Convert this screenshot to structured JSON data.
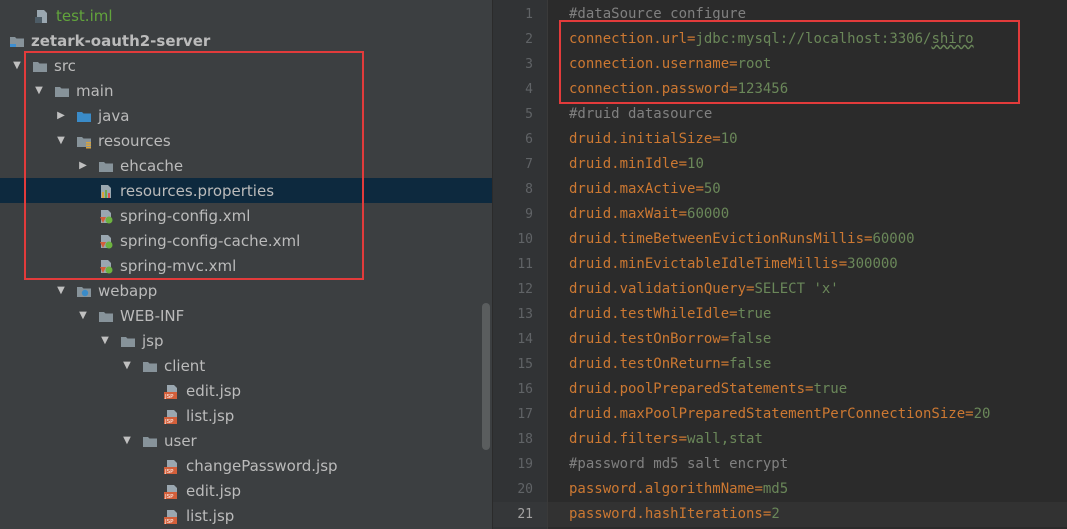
{
  "tree": {
    "items": [
      {
        "label": "test.iml",
        "icon": "iml-file-icon",
        "arrow": "none",
        "indent": 0,
        "green": true
      },
      {
        "label": "zetark-oauth2-server",
        "icon": "module-folder-icon",
        "arrow": "none",
        "indent": 0,
        "bold": true
      },
      {
        "label": "src",
        "icon": "folder-icon",
        "arrow": "expanded",
        "indent": 0
      },
      {
        "label": "main",
        "icon": "folder-icon",
        "arrow": "expanded",
        "indent": 1
      },
      {
        "label": "java",
        "icon": "source-folder-icon",
        "arrow": "collapsed",
        "indent": 2
      },
      {
        "label": "resources",
        "icon": "resources-folder-icon",
        "arrow": "expanded",
        "indent": 2
      },
      {
        "label": "ehcache",
        "icon": "folder-icon",
        "arrow": "collapsed",
        "indent": 3
      },
      {
        "label": "resources.properties",
        "icon": "properties-file-icon",
        "arrow": "none",
        "indent": 3,
        "selected": true
      },
      {
        "label": "spring-config.xml",
        "icon": "spring-xml-icon",
        "arrow": "none",
        "indent": 3
      },
      {
        "label": "spring-config-cache.xml",
        "icon": "spring-xml-icon",
        "arrow": "none",
        "indent": 3
      },
      {
        "label": "spring-mvc.xml",
        "icon": "spring-xml-icon",
        "arrow": "none",
        "indent": 3
      },
      {
        "label": "webapp",
        "icon": "web-folder-icon",
        "arrow": "expanded",
        "indent": 2
      },
      {
        "label": "WEB-INF",
        "icon": "folder-icon",
        "arrow": "expanded",
        "indent": 3
      },
      {
        "label": "jsp",
        "icon": "folder-icon",
        "arrow": "expanded",
        "indent": 4
      },
      {
        "label": "client",
        "icon": "folder-icon",
        "arrow": "expanded",
        "indent": 5
      },
      {
        "label": "edit.jsp",
        "icon": "jsp-file-icon",
        "arrow": "none",
        "indent": 6
      },
      {
        "label": "list.jsp",
        "icon": "jsp-file-icon",
        "arrow": "none",
        "indent": 6
      },
      {
        "label": "user",
        "icon": "folder-icon",
        "arrow": "expanded",
        "indent": 5
      },
      {
        "label": "changePassword.jsp",
        "icon": "jsp-file-icon",
        "arrow": "none",
        "indent": 6
      },
      {
        "label": "edit.jsp",
        "icon": "jsp-file-icon",
        "arrow": "none",
        "indent": 6
      },
      {
        "label": "list.jsp",
        "icon": "jsp-file-icon",
        "arrow": "none",
        "indent": 6
      }
    ]
  },
  "editor": {
    "current_line": 21,
    "lines": [
      {
        "n": "1",
        "type": "comment",
        "text": "#dataSource configure"
      },
      {
        "n": "2",
        "type": "kv",
        "key": "connection.url",
        "value": "jdbc:mysql://localhost:3306/",
        "value_underlined": "shiro"
      },
      {
        "n": "3",
        "type": "kv",
        "key": "connection.username",
        "value": "root"
      },
      {
        "n": "4",
        "type": "kv",
        "key": "connection.password",
        "value": "123456"
      },
      {
        "n": "5",
        "type": "comment",
        "text": "#druid datasource"
      },
      {
        "n": "6",
        "type": "kv",
        "key": "druid.initialSize",
        "value": "10"
      },
      {
        "n": "7",
        "type": "kv",
        "key": "druid.minIdle",
        "value": "10"
      },
      {
        "n": "8",
        "type": "kv",
        "key": "druid.maxActive",
        "value": "50"
      },
      {
        "n": "9",
        "type": "kv",
        "key": "druid.maxWait",
        "value": "60000"
      },
      {
        "n": "10",
        "type": "kv",
        "key": "druid.timeBetweenEvictionRunsMillis",
        "value": "60000"
      },
      {
        "n": "11",
        "type": "kv",
        "key": "druid.minEvictableIdleTimeMillis",
        "value": "300000"
      },
      {
        "n": "12",
        "type": "kv",
        "key": "druid.validationQuery",
        "value": "SELECT 'x'"
      },
      {
        "n": "13",
        "type": "kv",
        "key": "druid.testWhileIdle",
        "value": "true"
      },
      {
        "n": "14",
        "type": "kv",
        "key": "druid.testOnBorrow",
        "value": "false"
      },
      {
        "n": "15",
        "type": "kv",
        "key": "druid.testOnReturn",
        "value": "false"
      },
      {
        "n": "16",
        "type": "kv",
        "key": "druid.poolPreparedStatements",
        "value": "true"
      },
      {
        "n": "17",
        "type": "kv",
        "key": "druid.maxPoolPreparedStatementPerConnectionSize",
        "value": "20"
      },
      {
        "n": "18",
        "type": "kv",
        "key": "druid.filters",
        "value": "wall,stat"
      },
      {
        "n": "19",
        "type": "comment",
        "text": "#password md5 salt encrypt"
      },
      {
        "n": "20",
        "type": "kv",
        "key": "password.algorithmName",
        "value": "md5"
      },
      {
        "n": "21",
        "type": "kv",
        "key": "password.hashIterations",
        "value": "2"
      }
    ]
  },
  "colors": {
    "highlight_box": "#e23b3b",
    "key": "#cc7832",
    "value": "#6a8759",
    "comment": "#808080",
    "selection": "#0d293e"
  }
}
